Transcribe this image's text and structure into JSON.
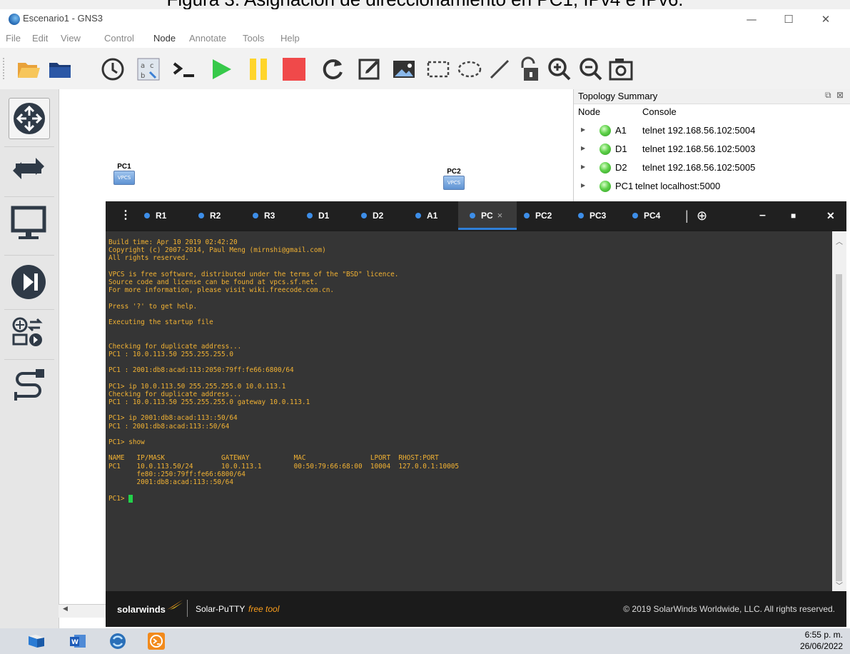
{
  "caption": "Figura 3. Asignación de direccionamiento en PC1, IPv4 e IPv6.",
  "window": {
    "title": "Escenario1 - GNS3",
    "controls": {
      "minimize": "—",
      "maximize": "☐",
      "close": "✕"
    }
  },
  "menu": [
    "File",
    "Edit",
    "View",
    "Control",
    "Node",
    "Annotate",
    "Tools",
    "Help"
  ],
  "toolbar_icons": [
    "open-folder-icon",
    "folder-icon",
    "clock-icon",
    "snapshot-icon",
    "console-icon",
    "start-icon",
    "pause-icon",
    "stop-icon",
    "reload-icon",
    "edit-note-icon",
    "image-icon",
    "rectangle-icon",
    "ellipse-icon",
    "line-icon",
    "lock-icon",
    "zoom-in-icon",
    "zoom-out-icon",
    "screenshot-icon"
  ],
  "canvas": {
    "nodes": [
      {
        "label": "PC1",
        "badge": "VPCS"
      },
      {
        "label": "PC2",
        "badge": "VPCS"
      }
    ]
  },
  "topology": {
    "title": "Topology Summary",
    "columns": [
      "Node",
      "Console"
    ],
    "rows": [
      {
        "node": "A1",
        "console": "telnet 192.168.56.102:5004"
      },
      {
        "node": "D1",
        "console": "telnet 192.168.56.102:5003"
      },
      {
        "node": "D2",
        "console": "telnet 192.168.56.102:5005"
      },
      {
        "node": "PC1",
        "console": "telnet localhost:5000"
      }
    ],
    "status_color": "#4cc23a"
  },
  "putty": {
    "tabs": [
      "R1",
      "R2",
      "R3",
      "D1",
      "D2",
      "A1",
      "PC",
      "PC2",
      "PC3",
      "PC4"
    ],
    "active_tab": "PC",
    "active_close": "×",
    "add_tab": "⊕",
    "controls": {
      "minimize": "–",
      "maximize": "■",
      "close": "✕"
    },
    "menu": "⋮",
    "terminal": {
      "lines": [
        "Build time: Apr 10 2019 02:42:20",
        "Copyright (c) 2007-2014, Paul Meng (mirnshi@gmail.com)",
        "All rights reserved.",
        "",
        "VPCS is free software, distributed under the terms of the \"BSD\" licence.",
        "Source code and license can be found at vpcs.sf.net.",
        "For more information, please visit wiki.freecode.com.cn.",
        "",
        "Press '?' to get help.",
        "",
        "Executing the startup file",
        "",
        "",
        "Checking for duplicate address...",
        "PC1 : 10.0.113.50 255.255.255.0",
        "",
        "PC1 : 2001:db8:acad:113:2050:79ff:fe66:6800/64",
        "",
        "PC1> ip 10.0.113.50 255.255.255.0 10.0.113.1",
        "Checking for duplicate address...",
        "PC1 : 10.0.113.50 255.255.255.0 gateway 10.0.113.1",
        "",
        "PC1> ip 2001:db8:acad:113::50/64",
        "PC1 : 2001:db8:acad:113::50/64",
        "",
        "PC1> show",
        "",
        "NAME   IP/MASK              GATEWAY           MAC                LPORT  RHOST:PORT",
        "PC1    10.0.113.50/24       10.0.113.1        00:50:79:66:68:00  10004  127.0.0.1:10005",
        "       fe80::250:79ff:fe66:6800/64",
        "       2001:db8:acad:113::50/64",
        ""
      ],
      "prompt": "PC1> ",
      "text_color": "#f2b233",
      "background": "#353535"
    },
    "footer": {
      "brand": "solarwinds",
      "product": "Solar-PuTTY",
      "tag": "free tool",
      "copyright": "© 2019 SolarWinds Worldwide, LLC. All rights reserved."
    }
  },
  "taskbar": {
    "apps": [
      "explorer-icon",
      "word-icon",
      "gns3-icon",
      "solar-putty-icon"
    ],
    "time": "6:55 p. m.",
    "date": "26/06/2022"
  }
}
